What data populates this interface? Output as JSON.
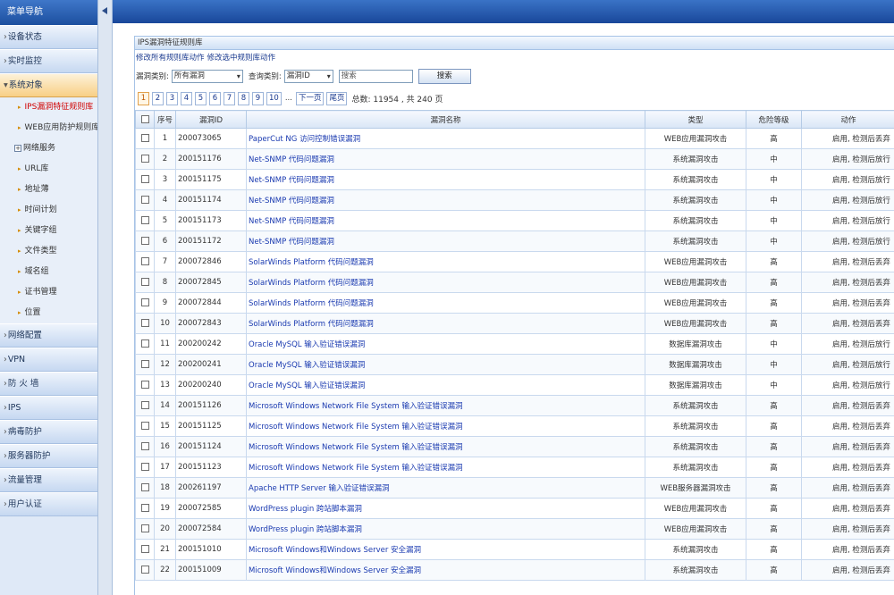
{
  "sidebar": {
    "title": "菜单导航",
    "top_items": [
      {
        "label": "设备状态",
        "prefix": "›"
      },
      {
        "label": "实时监控",
        "prefix": "›"
      },
      {
        "label": "系统对象",
        "prefix": "▾"
      }
    ],
    "sub_items": [
      {
        "label": "IPS漏洞特征规则库"
      },
      {
        "label": "WEB应用防护规则库"
      },
      {
        "label": "网络服务",
        "prefix": "+"
      },
      {
        "label": "URL库"
      },
      {
        "label": "地址薄"
      },
      {
        "label": "时间计划"
      },
      {
        "label": "关键字组"
      },
      {
        "label": "文件类型"
      },
      {
        "label": "域名组"
      },
      {
        "label": "证书管理"
      },
      {
        "label": "位置"
      }
    ],
    "bottom_items": [
      {
        "label": "网络配置",
        "prefix": "›"
      },
      {
        "label": "VPN",
        "prefix": "›"
      },
      {
        "label": "防 火 墙",
        "prefix": "›"
      },
      {
        "label": "IPS",
        "prefix": "›"
      },
      {
        "label": "病毒防护",
        "prefix": "›"
      },
      {
        "label": "服务器防护",
        "prefix": "›"
      },
      {
        "label": "流量管理",
        "prefix": "›"
      },
      {
        "label": "用户认证",
        "prefix": "›"
      }
    ]
  },
  "panel": {
    "title": "IPS漏洞特征规则库",
    "links": [
      "修改所有规则库动作",
      "修改选中规则库动作"
    ],
    "filter": {
      "category_label": "漏洞类别:",
      "category_value": "所有漏洞",
      "query_label": "查询类别:",
      "query_value": "漏洞ID",
      "search_placeholder": "搜索",
      "search_button": "搜索"
    },
    "pager": {
      "pages": [
        "1",
        "2",
        "3",
        "4",
        "5",
        "6",
        "7",
        "8",
        "9",
        "10"
      ],
      "ellipsis": "...",
      "next": "下一页",
      "last": "尾页",
      "total": "总数: 11954 , 共 240 页"
    }
  },
  "table": {
    "headers": {
      "index": "序号",
      "id": "漏洞ID",
      "name": "漏洞名称",
      "type": "类型",
      "level": "危险等级",
      "action": "动作"
    },
    "rows": [
      {
        "index": "1",
        "id": "200073065",
        "name": "PaperCut NG 访问控制错误漏洞",
        "type": "WEB应用漏洞攻击",
        "level": "高",
        "action": "启用, 检测后丢弃"
      },
      {
        "index": "2",
        "id": "200151176",
        "name": "Net-SNMP 代码问题漏洞",
        "type": "系统漏洞攻击",
        "level": "中",
        "action": "启用, 检测后放行"
      },
      {
        "index": "3",
        "id": "200151175",
        "name": "Net-SNMP 代码问题漏洞",
        "type": "系统漏洞攻击",
        "level": "中",
        "action": "启用, 检测后放行"
      },
      {
        "index": "4",
        "id": "200151174",
        "name": "Net-SNMP 代码问题漏洞",
        "type": "系统漏洞攻击",
        "level": "中",
        "action": "启用, 检测后放行"
      },
      {
        "index": "5",
        "id": "200151173",
        "name": "Net-SNMP 代码问题漏洞",
        "type": "系统漏洞攻击",
        "level": "中",
        "action": "启用, 检测后放行"
      },
      {
        "index": "6",
        "id": "200151172",
        "name": "Net-SNMP 代码问题漏洞",
        "type": "系统漏洞攻击",
        "level": "中",
        "action": "启用, 检测后放行"
      },
      {
        "index": "7",
        "id": "200072846",
        "name": "SolarWinds Platform 代码问题漏洞",
        "type": "WEB应用漏洞攻击",
        "level": "高",
        "action": "启用, 检测后丢弃"
      },
      {
        "index": "8",
        "id": "200072845",
        "name": "SolarWinds Platform 代码问题漏洞",
        "type": "WEB应用漏洞攻击",
        "level": "高",
        "action": "启用, 检测后丢弃"
      },
      {
        "index": "9",
        "id": "200072844",
        "name": "SolarWinds Platform 代码问题漏洞",
        "type": "WEB应用漏洞攻击",
        "level": "高",
        "action": "启用, 检测后丢弃"
      },
      {
        "index": "10",
        "id": "200072843",
        "name": "SolarWinds Platform 代码问题漏洞",
        "type": "WEB应用漏洞攻击",
        "level": "高",
        "action": "启用, 检测后丢弃"
      },
      {
        "index": "11",
        "id": "200200242",
        "name": "Oracle MySQL 输入验证错误漏洞",
        "type": "数据库漏洞攻击",
        "level": "中",
        "action": "启用, 检测后放行"
      },
      {
        "index": "12",
        "id": "200200241",
        "name": "Oracle MySQL 输入验证错误漏洞",
        "type": "数据库漏洞攻击",
        "level": "中",
        "action": "启用, 检测后放行"
      },
      {
        "index": "13",
        "id": "200200240",
        "name": "Oracle MySQL 输入验证错误漏洞",
        "type": "数据库漏洞攻击",
        "level": "中",
        "action": "启用, 检测后放行"
      },
      {
        "index": "14",
        "id": "200151126",
        "name": "Microsoft Windows Network File System 输入验证错误漏洞",
        "type": "系统漏洞攻击",
        "level": "高",
        "action": "启用, 检测后丢弃"
      },
      {
        "index": "15",
        "id": "200151125",
        "name": "Microsoft Windows Network File System 输入验证错误漏洞",
        "type": "系统漏洞攻击",
        "level": "高",
        "action": "启用, 检测后丢弃"
      },
      {
        "index": "16",
        "id": "200151124",
        "name": "Microsoft Windows Network File System 输入验证错误漏洞",
        "type": "系统漏洞攻击",
        "level": "高",
        "action": "启用, 检测后丢弃"
      },
      {
        "index": "17",
        "id": "200151123",
        "name": "Microsoft Windows Network File System 输入验证错误漏洞",
        "type": "系统漏洞攻击",
        "level": "高",
        "action": "启用, 检测后丢弃"
      },
      {
        "index": "18",
        "id": "200261197",
        "name": "Apache HTTP Server 输入验证错误漏洞",
        "type": "WEB服务器漏洞攻击",
        "level": "高",
        "action": "启用, 检测后丢弃"
      },
      {
        "index": "19",
        "id": "200072585",
        "name": "WordPress plugin 跨站脚本漏洞",
        "type": "WEB应用漏洞攻击",
        "level": "高",
        "action": "启用, 检测后丢弃"
      },
      {
        "index": "20",
        "id": "200072584",
        "name": "WordPress plugin 跨站脚本漏洞",
        "type": "WEB应用漏洞攻击",
        "level": "高",
        "action": "启用, 检测后丢弃"
      },
      {
        "index": "21",
        "id": "200151010",
        "name": "Microsoft Windows和Windows Server 安全漏洞",
        "type": "系统漏洞攻击",
        "level": "高",
        "action": "启用, 检测后丢弃"
      },
      {
        "index": "22",
        "id": "200151009",
        "name": "Microsoft Windows和Windows Server 安全漏洞",
        "type": "系统漏洞攻击",
        "level": "高",
        "action": "启用, 检测后丢弃"
      }
    ]
  }
}
